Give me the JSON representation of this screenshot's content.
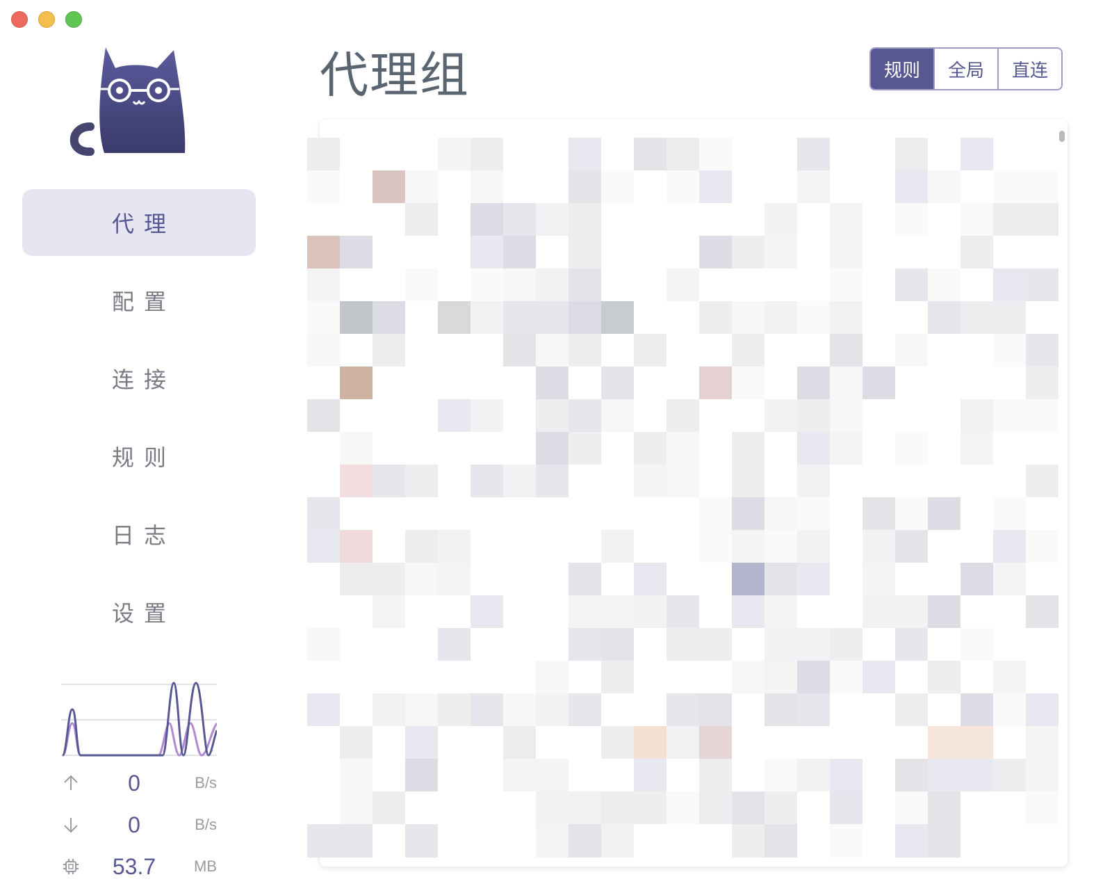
{
  "window": {
    "controls": [
      "close",
      "minimize",
      "maximize"
    ]
  },
  "sidebar": {
    "logo_icon": "cat-logo-icon",
    "items": [
      {
        "label": "代理",
        "active": true
      },
      {
        "label": "配置",
        "active": false
      },
      {
        "label": "连接",
        "active": false
      },
      {
        "label": "规则",
        "active": false
      },
      {
        "label": "日志",
        "active": false
      },
      {
        "label": "设置",
        "active": false
      }
    ],
    "stats": {
      "upload": {
        "icon": "arrow-up-icon",
        "value": "0",
        "unit": "B/s"
      },
      "download": {
        "icon": "arrow-down-icon",
        "value": "0",
        "unit": "B/s"
      },
      "memory": {
        "icon": "chip-icon",
        "value": "53.7",
        "unit": "MB"
      }
    }
  },
  "main": {
    "title": "代理组",
    "mode_switch": {
      "options": [
        "规则",
        "全局",
        "直连"
      ],
      "selected": "规则"
    }
  },
  "colors": {
    "accent": "#575892",
    "active_nav_bg": "#e6e5f1",
    "nav_text": "#7a7a84",
    "title_text": "#5a6571"
  }
}
